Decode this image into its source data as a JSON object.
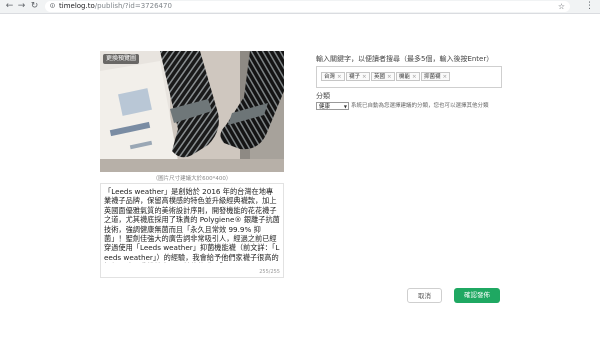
{
  "browser": {
    "url_host": "timelog.to",
    "url_path": "/publish/?id=3726470",
    "back_icon": "arrow-left-icon",
    "forward_icon": "arrow-right-icon",
    "reload_icon": "reload-icon",
    "home_icon": "home-icon",
    "star_icon": "star-icon",
    "menu_icon": "kebab-menu-icon"
  },
  "post": {
    "change_image_label": "更換預覽圖",
    "image_hint": "（圖片尺寸建議大於600*400）",
    "content": "「Leeds weather」是創始於 2016 年的台灣在地專業襪子品牌，保留高樸感的特色並升級經典襪款，加上英國面優雅氣質的美術設計序則，開發機能的花花襪子之道，尤其襪底採用了珠貴的 Polygiene® 銀離子抗菌技術，強調健康無菌而且「永久且常效 99.9% 抑菌」！聖劍佳強大的廣告詞非常吸引人，經過之前已經穿過使用「Leeds weather」抑菌機能襪（前文詳：「Leeds weather」）的經驗，我會給予他們家襪子很高的評價；這回我繼續宅配了其他款式：「DRIZZLE FEELING 細",
    "char_count": "255/255"
  },
  "keywords": {
    "label": "輸入關鍵字，以便讀者搜尋（最多5個，輸入後按Enter）",
    "tags": [
      "台灣",
      "襪子",
      "英國",
      "機能",
      "抑菌襪"
    ]
  },
  "category": {
    "label": "分類",
    "selected": "健康",
    "hint": "系統已自動為您選擇建議的分類，您也可以選擇其他分類"
  },
  "actions": {
    "cancel_label": "取消",
    "publish_label": "確認發佈"
  },
  "colors": {
    "accent": "#1fa862",
    "chrome_bg": "#f1f3f4"
  }
}
